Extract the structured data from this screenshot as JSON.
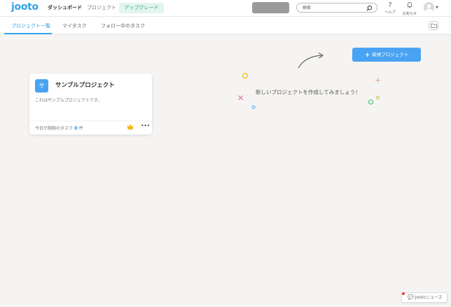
{
  "header": {
    "logo": "jooto",
    "nav": {
      "dashboard": "ダッシュボード",
      "projects": "プロジェクト",
      "upgrade": "アップグレード"
    },
    "search": {
      "placeholder": "検索"
    },
    "help_label": "ヘルプ",
    "notifications_label": "お知らせ"
  },
  "tabs": [
    {
      "label": "プロジェクト一覧",
      "active": true
    },
    {
      "label": "マイタスク",
      "active": false
    },
    {
      "label": "フォロー中のタスク",
      "active": false
    }
  ],
  "actions": {
    "new_project": "新規プロジェクト"
  },
  "empty_state": {
    "message": "新しいプロジェクトを作成してみましょう！"
  },
  "project_card": {
    "avatar_letter": "サ",
    "title": "サンプルプロジェクト",
    "description": "これはサンプルプロジェクトです。",
    "due_today_label": "今日が期限のタスク",
    "due_today_count": "0",
    "due_today_unit": "件"
  },
  "news_button": {
    "label": "Jootoニュース"
  },
  "colors": {
    "brand": "#2fa4e7",
    "primary_button": "#4aa3f2",
    "upgrade_bg": "#e2f5ee",
    "upgrade_text": "#3aa77b",
    "page_bg": "#f5f4f2"
  }
}
